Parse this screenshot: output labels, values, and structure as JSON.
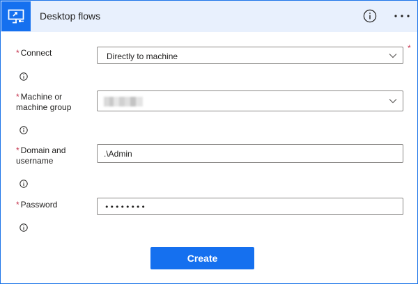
{
  "header": {
    "title": "Desktop flows",
    "icon": "desktop-flow-icon",
    "info_icon": "info-icon",
    "more_icon": "more-options-icon",
    "accent": "#1570ef",
    "background": "#e8f0fd"
  },
  "form": {
    "required_marker": "*",
    "connect": {
      "label": "Connect",
      "value": "Directly to machine"
    },
    "machine": {
      "label_line1": "Machine or",
      "label_line2": "machine group",
      "value": ""
    },
    "domain": {
      "label_line1": "Domain and",
      "label_line2": "username",
      "value": ".\\Admin"
    },
    "password": {
      "label": "Password",
      "masked_value": "••••••••"
    }
  },
  "actions": {
    "create_label": "Create"
  }
}
